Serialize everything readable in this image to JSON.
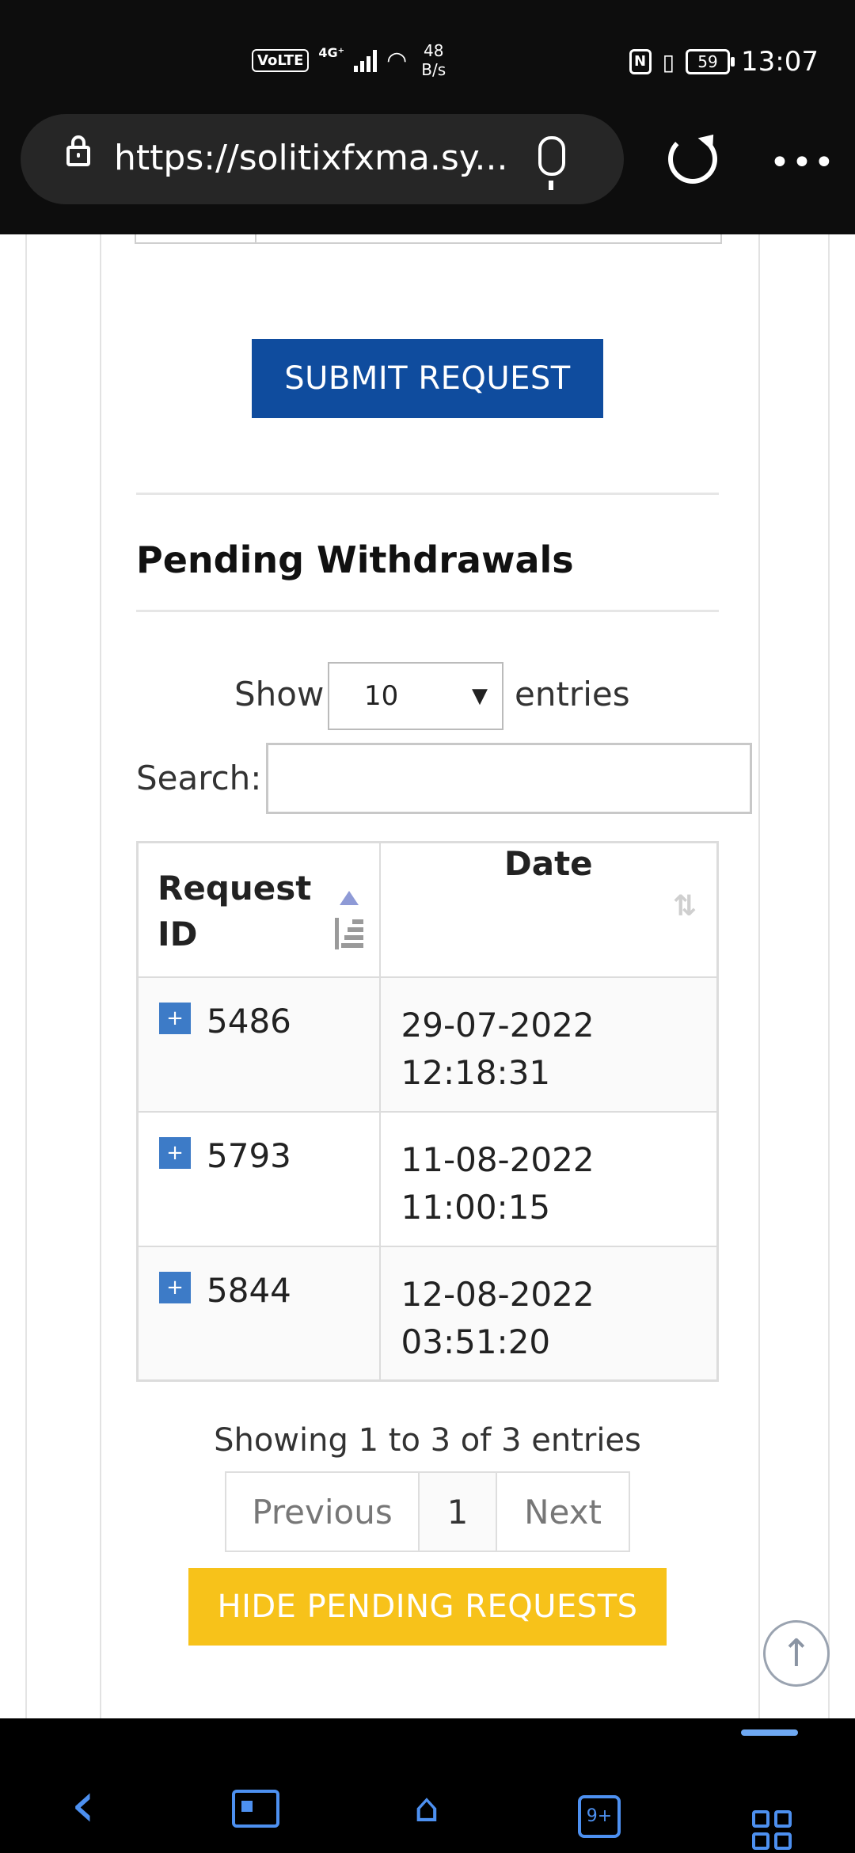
{
  "status_bar": {
    "volte": "VoLTE",
    "network": "4G⁺",
    "speed_value": "48",
    "speed_unit": "B/s",
    "nfc": "N",
    "battery": "59",
    "time": "13:07"
  },
  "browser": {
    "url": "https://solitixfxma.sy...",
    "menu": "•••"
  },
  "form": {
    "submit_label": "SUBMIT REQUEST"
  },
  "pending": {
    "title": "Pending Withdrawals",
    "show_label": "Show",
    "page_length": "10",
    "entries_label": "entries",
    "search_label": "Search:",
    "columns": [
      "Request ID",
      "Date"
    ],
    "rows": [
      {
        "expand": "+",
        "id": "5486",
        "date": "29-07-2022",
        "time": "12:18:31"
      },
      {
        "expand": "+",
        "id": "5793",
        "date": "11-08-2022",
        "time": "11:00:15"
      },
      {
        "expand": "+",
        "id": "5844",
        "date": "12-08-2022",
        "time": "03:51:20"
      }
    ],
    "info": "Showing 1 to 3 of 3 entries",
    "pagination": {
      "previous": "Previous",
      "current": "1",
      "next": "Next"
    },
    "hide_label": "HIDE PENDING REQUESTS"
  },
  "scroll_top": "↑",
  "nav": {
    "back": "‹",
    "tabs_count": "9+"
  },
  "colors": {
    "submit_bg": "#0f4c9e",
    "hide_bg": "#f7c21a",
    "expand_bg": "#3d7bc7",
    "nav_icon": "#4d90f0"
  }
}
